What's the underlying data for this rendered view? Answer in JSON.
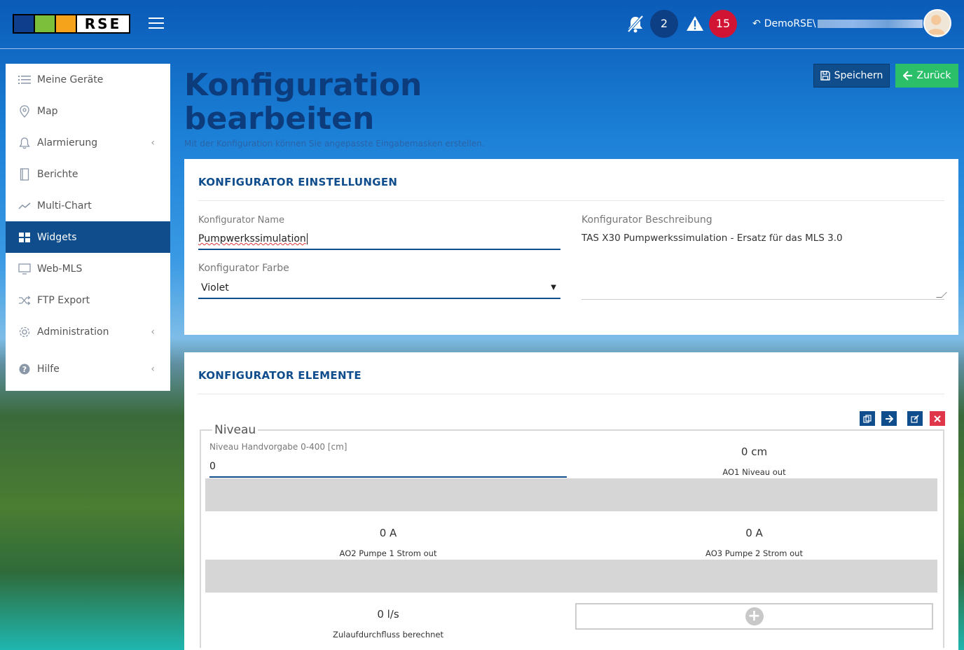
{
  "header": {
    "logo_text": "RSE",
    "logo_colors": [
      "#0f3f8c",
      "#7cbf3a",
      "#f5a31a"
    ],
    "notification_count": "2",
    "alert_count": "15",
    "user_name": "DemoRSE\\"
  },
  "sidebar": {
    "items": [
      {
        "label": "Meine Geräte",
        "icon": "list-icon"
      },
      {
        "label": "Map",
        "icon": "map-pin-icon"
      },
      {
        "label": "Alarmierung",
        "icon": "bell-icon"
      },
      {
        "label": "Berichte",
        "icon": "book-icon"
      },
      {
        "label": "Multi-Chart",
        "icon": "line-chart-icon"
      },
      {
        "label": "Widgets",
        "icon": "grid-icon"
      },
      {
        "label": "Web-MLS",
        "icon": "monitor-icon"
      },
      {
        "label": "FTP Export",
        "icon": "shuffle-icon"
      },
      {
        "label": "Administration",
        "icon": "gear-icon"
      },
      {
        "label": "Hilfe",
        "icon": "help-icon"
      }
    ],
    "active": "Widgets"
  },
  "page": {
    "title_line1": "Konfiguration",
    "title_line2": "bearbeiten",
    "subtitle": "Mit der Konfiguration können Sie angepasste Eingabemasken erstellen.",
    "save_label": "Speichern",
    "back_label": "Zurück"
  },
  "settings": {
    "title": "KONFIGURATOR EINSTELLUNGEN",
    "name_label": "Konfigurator Name",
    "name_value": "Pumpwerkssimulation",
    "color_label": "Konfigurator Farbe",
    "color_value": "Violet",
    "desc_label": "Konfigurator Beschreibung",
    "desc_value": "TAS X30 Pumpwerkssimulation - Ersatz für das MLS 3.0"
  },
  "elements": {
    "title": "KONFIGURATOR ELEMENTE",
    "group_title": "Niveau",
    "input_label": "Niveau Handvorgabe 0-400 [cm]",
    "input_value": "0",
    "ao1_value": "0  cm",
    "ao1_label": "AO1 Niveau out",
    "ao2_value": "0  A",
    "ao2_label": "AO2 Pumpe 1 Strom out",
    "ao3_value": "0  A",
    "ao3_label": "AO3 Pumpe 2 Strom out",
    "flow_value": "0  l/s",
    "flow_label": "Zulaufdurchfluss berechnet"
  }
}
